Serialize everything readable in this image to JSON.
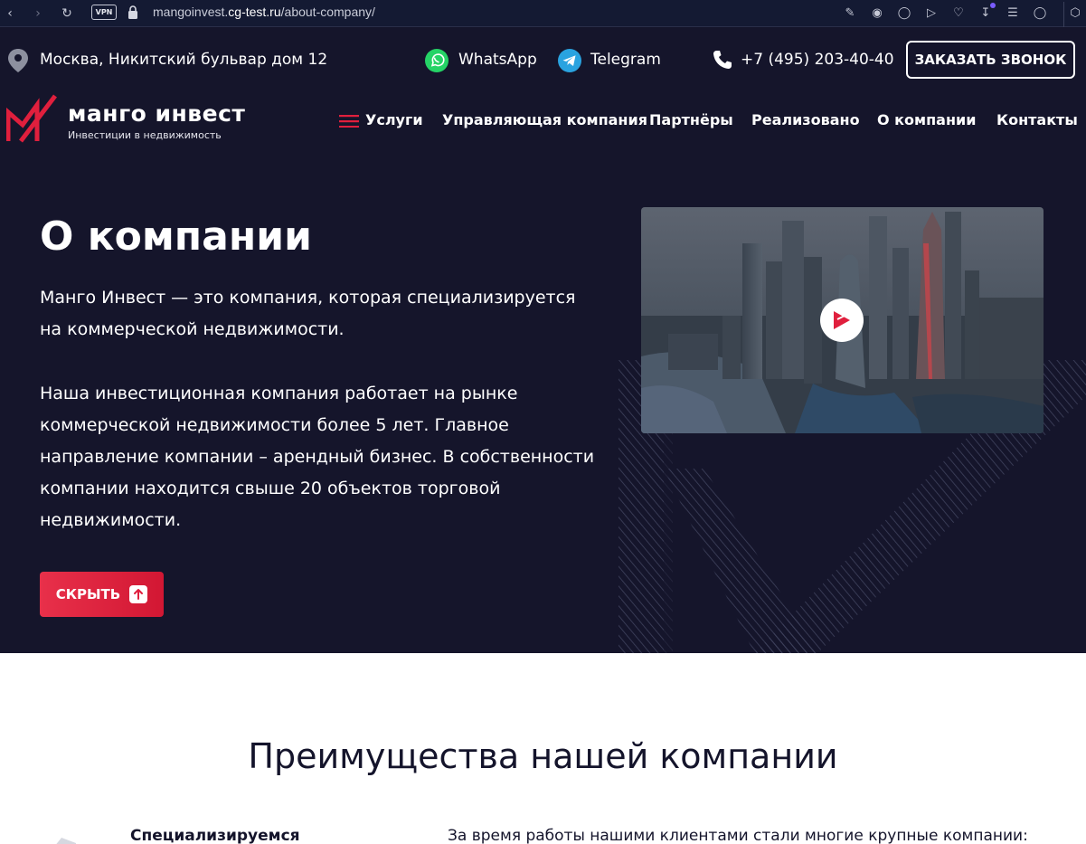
{
  "browser": {
    "url_host": "mangoinvest.",
    "url_domain": "cg-test.ru",
    "url_path": "/about-company/",
    "vpn_label": "VPN"
  },
  "topbar": {
    "address": "Москва, Никитский бульвар дом 12",
    "whatsapp": "WhatsApp",
    "telegram": "Telegram",
    "phone": "+7 (495) 203-40-40",
    "callback_button": "ЗАКАЗАТЬ ЗВОНОК"
  },
  "logo": {
    "name": "манго инвест",
    "tagline": "Инвестиции в недвижимость"
  },
  "nav": {
    "items": [
      "Услуги",
      "Управляющая компания",
      "Партнёры",
      "Реализовано",
      "О компании",
      "Контакты"
    ]
  },
  "hero": {
    "title": "О компании",
    "paragraph1": "Манго Инвест — это компания, которая специализируется на коммерческой недвижимости.",
    "paragraph2": "Наша инвестиционная компания работает на рынке коммерческой недвижимости более 5 лет. Главное направление компании – арендный бизнес. В собственности компании находится свыше 20 объектов торговой недвижимости.",
    "hide_button": "СКРЫТЬ"
  },
  "advantages": {
    "title": "Преимущества нашей компании",
    "first_item": "Специализируемся",
    "clients_text": "За время работы нашими клиентами стали многие крупные компании:"
  },
  "colors": {
    "background": "#15152b",
    "accent": "#e01f3d",
    "whatsapp": "#25d366",
    "telegram": "#2aa3e0"
  }
}
